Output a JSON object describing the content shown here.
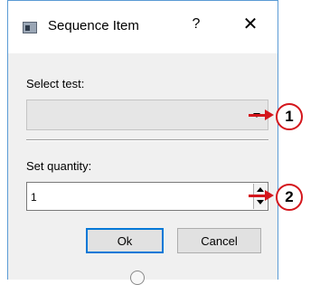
{
  "window": {
    "title": "Sequence Item",
    "help_label": "?",
    "close_label": "✕",
    "icon": "app-window-icon"
  },
  "select_test": {
    "label": "Select test:",
    "value": ""
  },
  "quantity": {
    "label": "Set quantity:",
    "value": "1"
  },
  "buttons": {
    "ok": "Ok",
    "cancel": "Cancel"
  },
  "callouts": [
    {
      "number": "1"
    },
    {
      "number": "2"
    }
  ],
  "colors": {
    "accent": "#0078d7",
    "callout": "#d4161c",
    "dialog_bg": "#f0f0f0"
  }
}
